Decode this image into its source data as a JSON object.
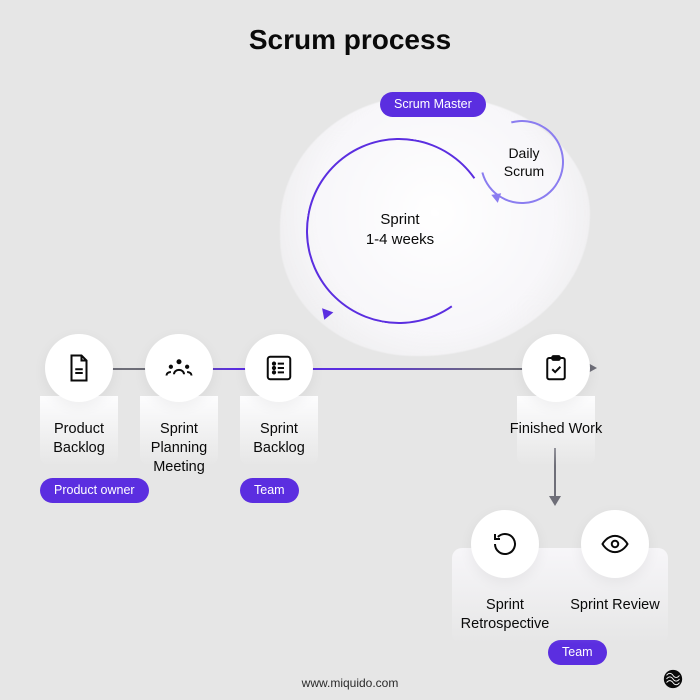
{
  "title": "Scrum process",
  "sprint": {
    "label_line1": "Sprint",
    "label_line2": "1-4 weeks"
  },
  "daily": {
    "label_line1": "Daily",
    "label_line2": "Scrum"
  },
  "pills": {
    "scrum_master": "Scrum Master",
    "product_owner": "Product owner",
    "team_top": "Team",
    "team_bottom": "Team"
  },
  "steps": {
    "product_backlog": "Product Backlog",
    "sprint_planning_meeting": "Sprint Planning Meeting",
    "sprint_backlog": "Sprint Backlog",
    "finished_work": "Finished Work",
    "sprint_retrospective": "Sprint Retrospective",
    "sprint_review": "Sprint Review"
  },
  "footer": "www.miquido.com",
  "colors": {
    "accent": "#5b2ee0",
    "accent_light": "#8b7df0",
    "bg": "#e6e6e6"
  }
}
